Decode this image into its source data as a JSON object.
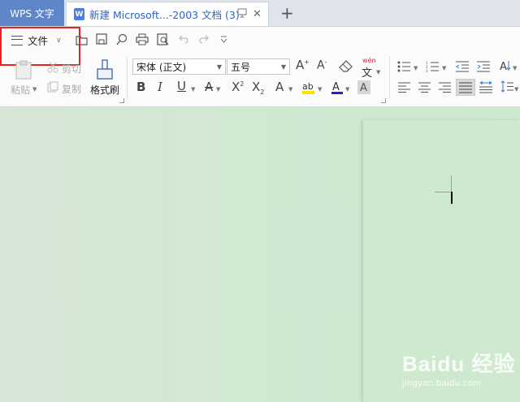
{
  "tabs": {
    "app_tab_label": "WPS 文字",
    "doc_tab_title": "新建 Microsoft...-2003 文档 (3)"
  },
  "menu": {
    "file_label": "文件"
  },
  "clipboard": {
    "paste_label": "粘贴",
    "cut_label": "剪切",
    "copy_label": "复制",
    "format_painter_label": "格式刷"
  },
  "font": {
    "family_value": "宋体 (正文)",
    "size_value": "五号",
    "pinyin_label": "wén",
    "pinyin_char": "文"
  },
  "watermark": {
    "main": "Baidu 经验",
    "sub": "jingyan.baidu.com"
  },
  "colors": {
    "app_tab": "#5f86c9",
    "highlight_box": "#e8231f",
    "workspace": "#d1e8d1"
  }
}
